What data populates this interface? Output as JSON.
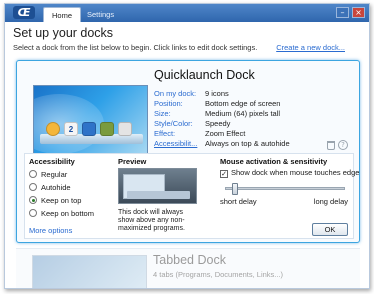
{
  "window": {
    "tabs": [
      {
        "label": "Home",
        "active": true
      },
      {
        "label": "Settings",
        "active": false
      }
    ],
    "minimize_glyph": "–",
    "close_glyph": "×"
  },
  "page": {
    "title": "Set up your docks",
    "subtitle": "Select a dock from the list below to begin. Click links to edit dock settings.",
    "create_link": "Create a new dock..."
  },
  "dock": {
    "title": "Quicklaunch Dock",
    "properties": [
      {
        "label": "On my dock:",
        "value": "9 icons"
      },
      {
        "label": "Position:",
        "value": "Bottom edge of screen"
      },
      {
        "label": "Size:",
        "value": "Medium (64) pixels tall"
      },
      {
        "label": "Style/Color:",
        "value": "Speedy"
      },
      {
        "label": "Effect:",
        "value": "Zoom Effect"
      },
      {
        "label": "Accessibilit...",
        "value": "Always on top & autohide"
      }
    ],
    "preview_icon_text": "2",
    "help_glyph": "?"
  },
  "accessibility": {
    "title": "Accessibility",
    "options": [
      {
        "label": "Regular",
        "checked": false
      },
      {
        "label": "Autohide",
        "checked": false
      },
      {
        "label": "Keep on top",
        "checked": true
      },
      {
        "label": "Keep on bottom",
        "checked": false
      }
    ],
    "more_options": "More options"
  },
  "preview": {
    "title": "Preview",
    "description": "This dock will always show above any non-maximized programs."
  },
  "mouse": {
    "title": "Mouse activation & sensitivity",
    "checkbox_label": "Show dock when mouse touches edge",
    "checkbox_checked": true,
    "check_glyph": "✓",
    "slider_value": 0.05,
    "slider_min_label": "short delay",
    "slider_max_label": "long delay"
  },
  "ok_button": "OK",
  "next_dock": {
    "title": "Tabbed Dock",
    "description": "4 tabs (Programs, Documents, Links...)"
  },
  "icons": {
    "app_logo": "app-logo-icon",
    "trash": "trash-icon",
    "help": "help-icon",
    "app_logo_text": "Œ"
  },
  "colors": {
    "titlebar": "#2f66ad",
    "link": "#2a6bd0",
    "selection_glow": "#3da5e0"
  }
}
